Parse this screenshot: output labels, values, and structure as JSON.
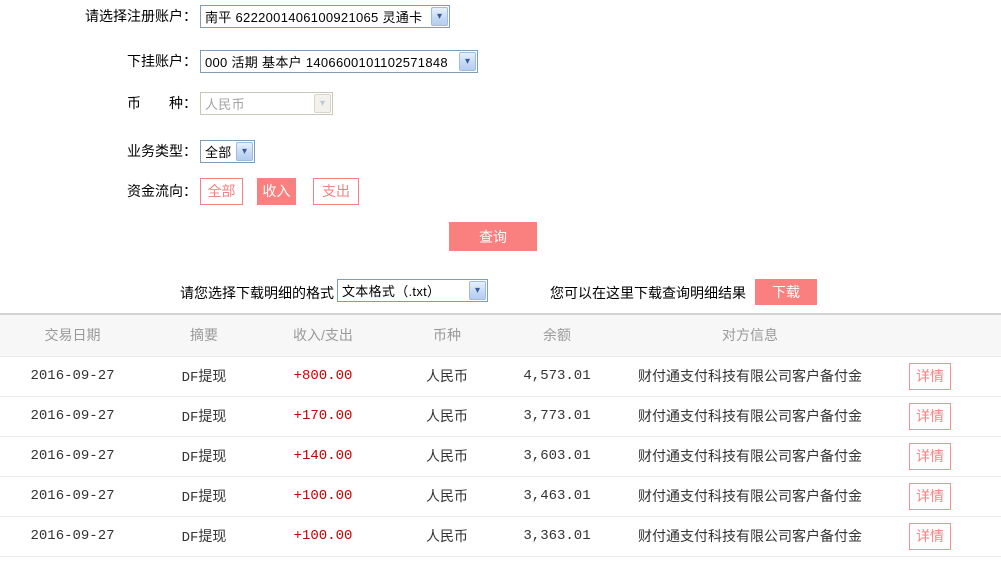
{
  "form": {
    "account": {
      "label": "请选择注册账户：",
      "value": "南平 6222001406100921065 灵通卡"
    },
    "sub_account": {
      "label": "下挂账户：",
      "value": "000 活期 基本户 1406600101102571848"
    },
    "currency": {
      "label": "币　　种：",
      "value": "人民币"
    },
    "biz_type": {
      "label": "业务类型：",
      "value": "全部"
    },
    "flow": {
      "label": "资金流向：",
      "options": [
        "全部",
        "收入",
        "支出"
      ],
      "selected": "收入"
    },
    "query_button": "查询"
  },
  "download": {
    "format_label": "请您选择下载明细的格式",
    "format_value": "文本格式（.txt）",
    "hint": "您可以在这里下载查询明细结果",
    "button": "下载"
  },
  "table": {
    "headers": {
      "date": "交易日期",
      "summary": "摘要",
      "amount": "收入/支出",
      "currency": "币种",
      "balance": "余额",
      "counterparty": "对方信息"
    },
    "action_label": "详情",
    "rows": [
      {
        "date": "2016-09-27",
        "summary": "DF提现",
        "amount": "+800.00",
        "currency": "人民币",
        "balance": "4,573.01",
        "counterparty": "财付通支付科技有限公司客户备付金"
      },
      {
        "date": "2016-09-27",
        "summary": "DF提现",
        "amount": "+170.00",
        "currency": "人民币",
        "balance": "3,773.01",
        "counterparty": "财付通支付科技有限公司客户备付金"
      },
      {
        "date": "2016-09-27",
        "summary": "DF提现",
        "amount": "+140.00",
        "currency": "人民币",
        "balance": "3,603.01",
        "counterparty": "财付通支付科技有限公司客户备付金"
      },
      {
        "date": "2016-09-27",
        "summary": "DF提现",
        "amount": "+100.00",
        "currency": "人民币",
        "balance": "3,463.01",
        "counterparty": "财付通支付科技有限公司客户备付金"
      },
      {
        "date": "2016-09-27",
        "summary": "DF提现",
        "amount": "+100.00",
        "currency": "人民币",
        "balance": "3,363.01",
        "counterparty": "财付通支付科技有限公司客户备付金"
      }
    ]
  },
  "colors": {
    "accent_pink": "#fa8080",
    "amount_red": "#cc0000"
  }
}
